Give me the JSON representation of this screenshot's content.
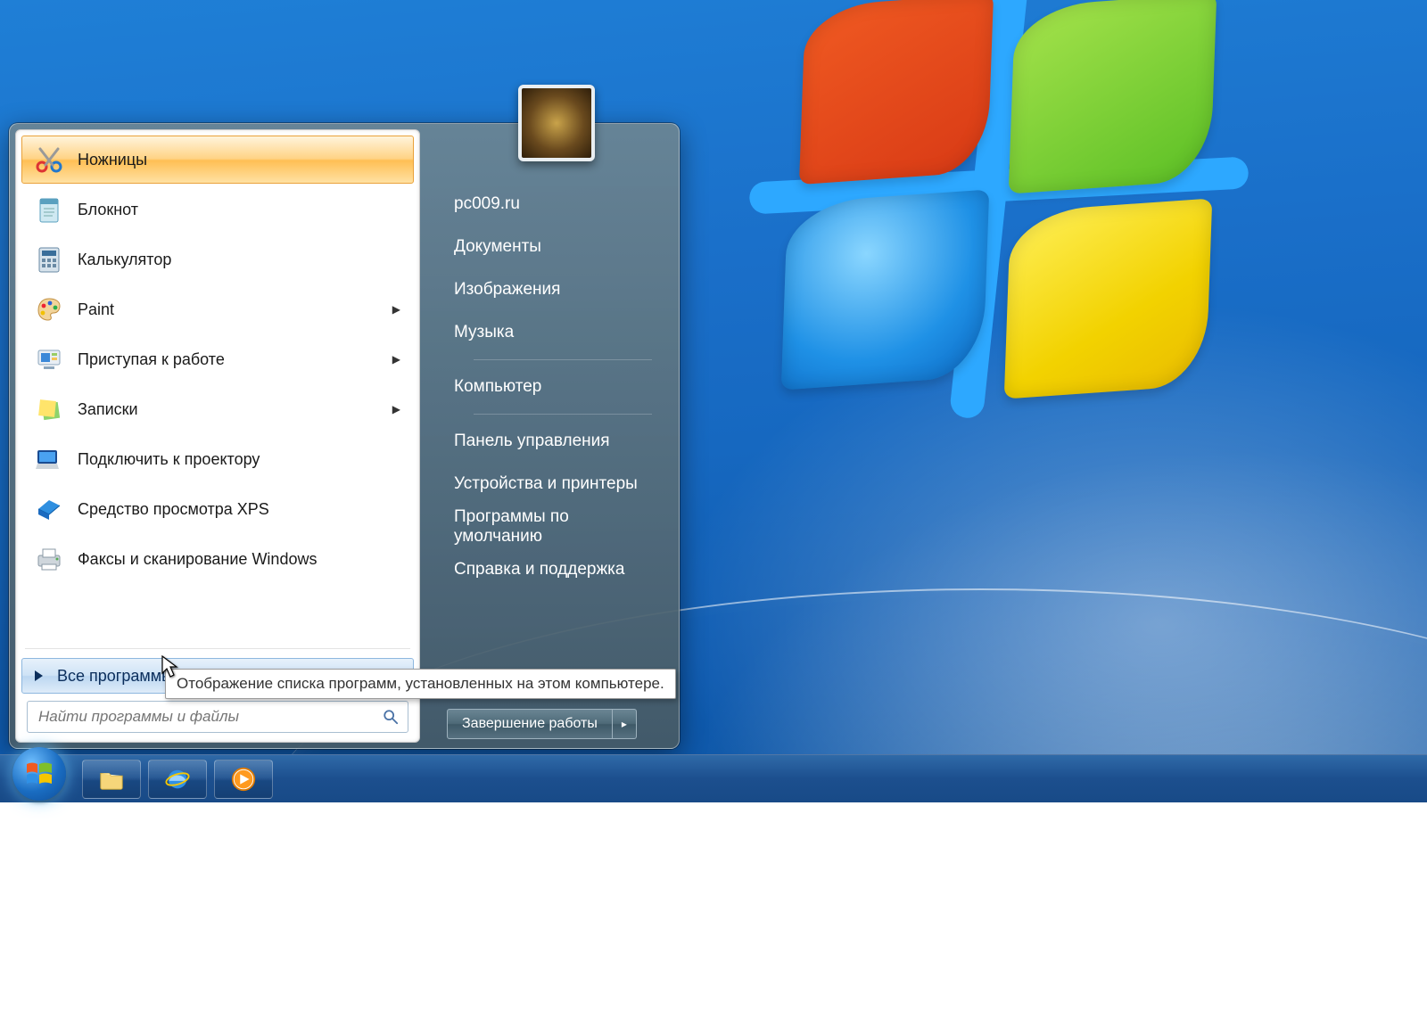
{
  "start_menu": {
    "programs": [
      {
        "label": "Ножницы",
        "submenu": false,
        "highlighted": true,
        "icon": "scissors-icon"
      },
      {
        "label": "Блокнот",
        "submenu": false,
        "highlighted": false,
        "icon": "notepad-icon"
      },
      {
        "label": "Калькулятор",
        "submenu": false,
        "highlighted": false,
        "icon": "calculator-icon"
      },
      {
        "label": "Paint",
        "submenu": true,
        "highlighted": false,
        "icon": "paint-icon"
      },
      {
        "label": "Приступая к работе",
        "submenu": true,
        "highlighted": false,
        "icon": "getting-started-icon"
      },
      {
        "label": "Записки",
        "submenu": true,
        "highlighted": false,
        "icon": "sticky-notes-icon"
      },
      {
        "label": "Подключить к проектору",
        "submenu": false,
        "highlighted": false,
        "icon": "projector-icon"
      },
      {
        "label": "Средство просмотра XPS",
        "submenu": false,
        "highlighted": false,
        "icon": "xps-viewer-icon"
      },
      {
        "label": "Факсы и сканирование Windows",
        "submenu": false,
        "highlighted": false,
        "icon": "fax-scan-icon"
      }
    ],
    "all_programs_label": "Все программы",
    "search_placeholder": "Найти программы и файлы",
    "right_links": {
      "user": "pc009.ru",
      "documents": "Документы",
      "pictures": "Изображения",
      "music": "Музыка",
      "computer": "Компьютер",
      "control_panel": "Панель управления",
      "devices": "Устройства и принтеры",
      "default_programs": "Программы по умолчанию",
      "help": "Справка и поддержка"
    },
    "shutdown_label": "Завершение работы",
    "tooltip": "Отображение списка программ, установленных на этом компьютере."
  }
}
